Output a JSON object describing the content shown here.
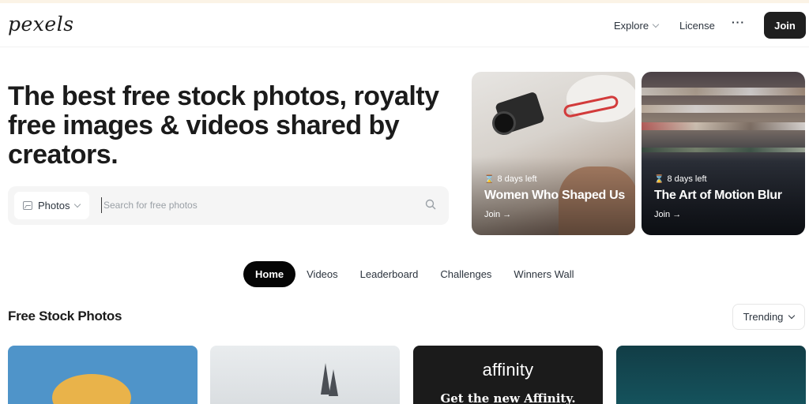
{
  "brand": {
    "logo": "pexels"
  },
  "nav": {
    "explore": "Explore",
    "license": "License",
    "more": "···",
    "join": "Join"
  },
  "hero": {
    "title": "The best free stock photos, royalty free images & videos shared by creators."
  },
  "search": {
    "type": "Photos",
    "placeholder": "Search for free photos"
  },
  "challenges": [
    {
      "days": "8 days left",
      "title": "Women Who Shaped Us",
      "join": "Join →"
    },
    {
      "days": "8 days left",
      "title": "The Art of Motion Blur",
      "join": "Join →"
    }
  ],
  "tabs": [
    {
      "label": "Home",
      "active": true
    },
    {
      "label": "Videos"
    },
    {
      "label": "Leaderboard"
    },
    {
      "label": "Challenges"
    },
    {
      "label": "Winners Wall"
    }
  ],
  "section": {
    "title": "Free Stock Photos",
    "sort": "Trending"
  },
  "photos": {
    "ad_logo": "affinity",
    "ad_headline": "Get the new Affinity."
  },
  "icons": {
    "search": "magnifier-icon",
    "image": "image-icon",
    "hourglass": "hourglass-icon"
  }
}
